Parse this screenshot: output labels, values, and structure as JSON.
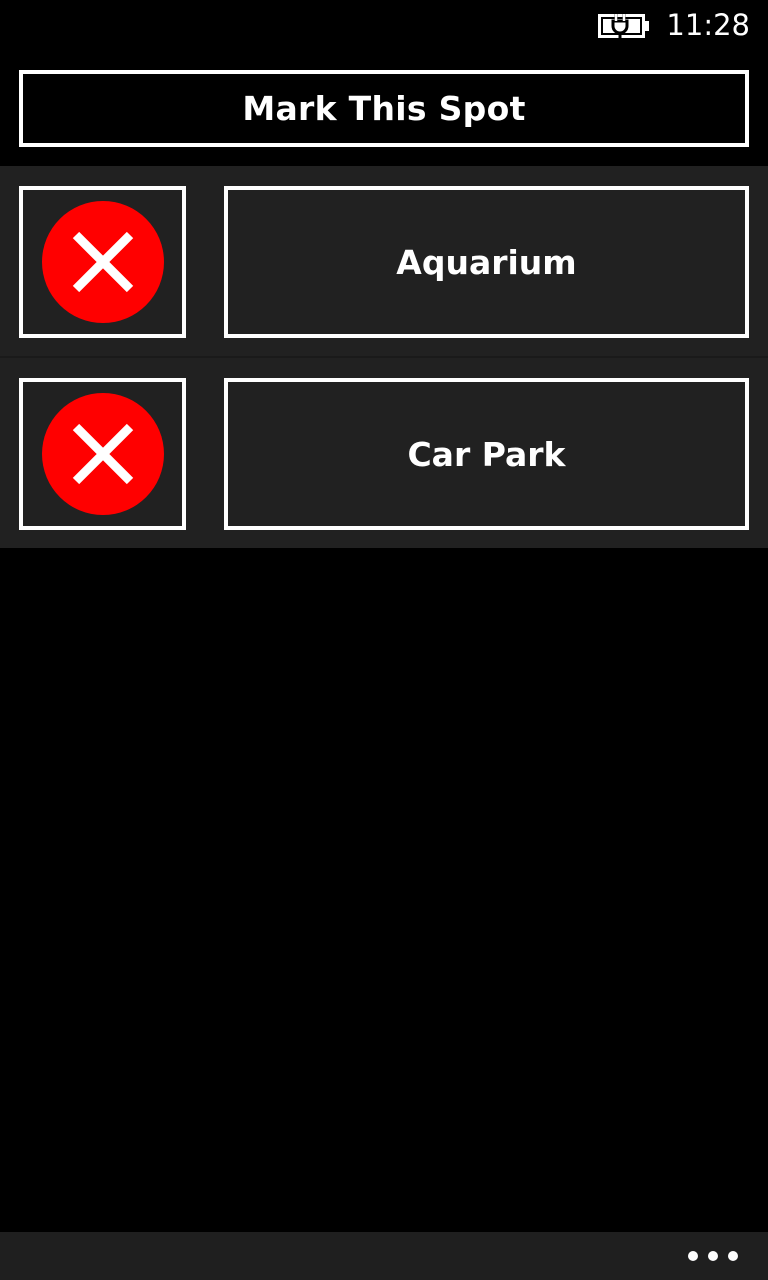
{
  "status_bar": {
    "time": "11:28",
    "battery_icon": "battery-charging-icon"
  },
  "header": {
    "mark_button_label": "Mark This Spot"
  },
  "spots": [
    {
      "label": "Aquarium",
      "delete_icon": "delete-icon"
    },
    {
      "label": "Car Park",
      "delete_icon": "delete-icon"
    }
  ],
  "app_bar": {
    "more_icon": "more-icon"
  },
  "colors": {
    "background": "#000000",
    "row_background": "#212121",
    "app_bar_background": "#1f1f1f",
    "delete_red": "#ff0000",
    "text": "#ffffff"
  }
}
